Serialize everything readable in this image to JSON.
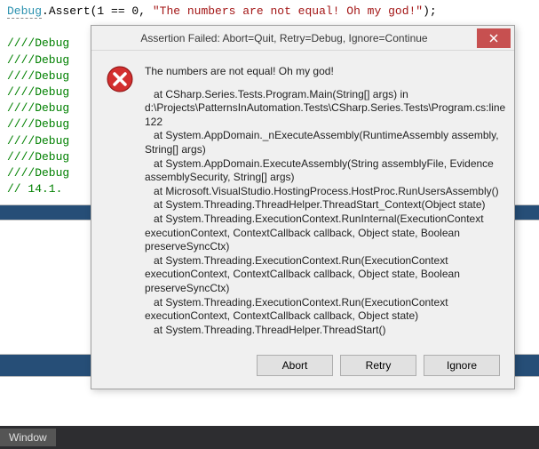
{
  "code": {
    "assert_class": "Debug",
    "assert_rest": ".Assert(1 == 0, ",
    "assert_str": "\"The numbers are not equal! Oh my god!\"",
    "assert_end": ");",
    "comments": [
      "////Debug                                                            ug o",
      "",
      "////Debug",
      "////Debug",
      "////Debug",
      "////Debug",
      "////Debug",
      "////Debug",
      "////Debug",
      "////Debug",
      "",
      "// 14.1."
    ]
  },
  "dialog": {
    "title": "Assertion Failed: Abort=Quit, Retry=Debug, Ignore=Continue",
    "headline": "The numbers are not equal! Oh my god!",
    "stacktrace": "   at CSharp.Series.Tests.Program.Main(String[] args) in d:\\Projects\\PatternsInAutomation.Tests\\CSharp.Series.Tests\\Program.cs:line 122\n   at System.AppDomain._nExecuteAssembly(RuntimeAssembly assembly, String[] args)\n   at System.AppDomain.ExecuteAssembly(String assemblyFile, Evidence assemblySecurity, String[] args)\n   at Microsoft.VisualStudio.HostingProcess.HostProc.RunUsersAssembly()\n   at System.Threading.ThreadHelper.ThreadStart_Context(Object state)\n   at System.Threading.ExecutionContext.RunInternal(ExecutionContext executionContext, ContextCallback callback, Object state, Boolean preserveSyncCtx)\n   at System.Threading.ExecutionContext.Run(ExecutionContext executionContext, ContextCallback callback, Object state, Boolean preserveSyncCtx)\n   at System.Threading.ExecutionContext.Run(ExecutionContext executionContext, ContextCallback callback, Object state)\n   at System.Threading.ThreadHelper.ThreadStart()",
    "buttons": {
      "abort": "Abort",
      "retry": "Retry",
      "ignore": "Ignore"
    }
  },
  "footer": {
    "label": "Window"
  }
}
